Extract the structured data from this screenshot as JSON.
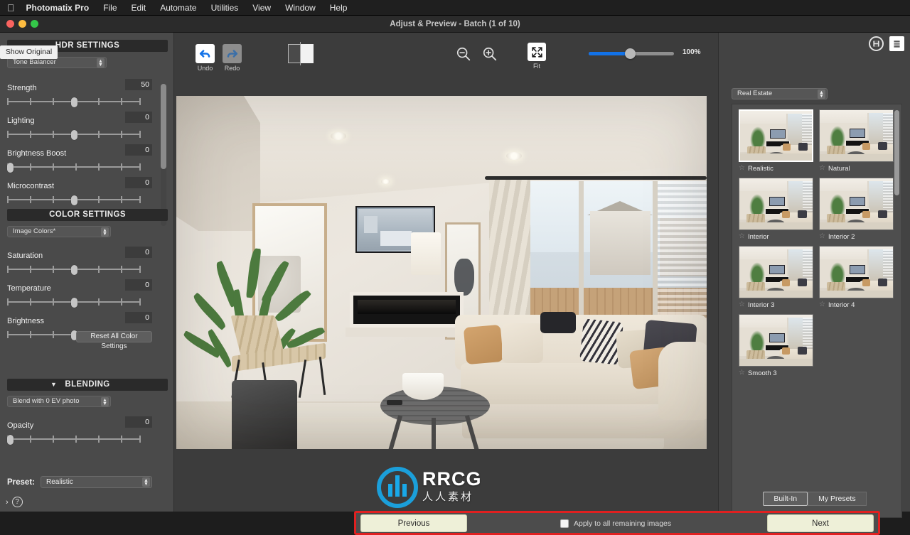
{
  "menubar": {
    "apple_icon": "apple-logo",
    "items": [
      "Photomatix Pro",
      "File",
      "Edit",
      "Automate",
      "Utilities",
      "View",
      "Window",
      "Help"
    ]
  },
  "window": {
    "title": "Adjust & Preview - Batch (1 of 10)",
    "traffic_lights": [
      "close",
      "minimize",
      "zoom"
    ]
  },
  "left_panel": {
    "hdr": {
      "header": "HDR SETTINGS",
      "method": "Tone Balancer",
      "sliders": [
        {
          "label": "Strength",
          "value": "50",
          "pos": 50
        },
        {
          "label": "Lighting",
          "value": "0",
          "pos": 50
        },
        {
          "label": "Brightness Boost",
          "value": "0",
          "pos": 2
        },
        {
          "label": "Microcontrast",
          "value": "0",
          "pos": 50
        }
      ]
    },
    "color": {
      "header": "COLOR SETTINGS",
      "mode": "Image Colors*",
      "sliders": [
        {
          "label": "Saturation",
          "value": "0",
          "pos": 50
        },
        {
          "label": "Temperature",
          "value": "0",
          "pos": 50
        },
        {
          "label": "Brightness",
          "value": "0",
          "pos": 50
        }
      ],
      "reset_label": "Reset All Color Settings"
    },
    "blending": {
      "header": "BLENDING",
      "chevron": "chevron-down-icon",
      "blend_with": "Blend with  0 EV photo",
      "sliders": [
        {
          "label": "Opacity",
          "value": "0",
          "pos": 2
        }
      ]
    },
    "preset_label": "Preset:",
    "preset_value": "Realistic",
    "help_chevron": "›",
    "help_icon": "?"
  },
  "toolbar": {
    "undo_label": "Undo",
    "redo_label": "Redo",
    "undo_icon": "undo-arrow-icon",
    "redo_icon": "redo-arrow-icon",
    "split_icon": "split-preview-icon",
    "show_original": "Show Original",
    "zoom_out_icon": "zoom-out-icon",
    "zoom_in_icon": "zoom-in-icon",
    "fit_label": "Fit",
    "fit_icon": "fit-to-screen-icon",
    "zoom_percent": "100%",
    "zoom_value": 100
  },
  "bottom_bar": {
    "previous": "Previous",
    "next": "Next",
    "apply_label": "Apply to all remaining images",
    "apply_checked": false,
    "highlight_color": "#e02020"
  },
  "right_panel": {
    "save_icon": "save-preset-icon",
    "list_icon": "list-view-icon",
    "category": "Real Estate",
    "presets": [
      {
        "name": "Realistic",
        "selected": true,
        "favorite": false
      },
      {
        "name": "Natural",
        "selected": false,
        "favorite": false
      },
      {
        "name": "Interior",
        "selected": false,
        "favorite": false
      },
      {
        "name": "Interior 2",
        "selected": false,
        "favorite": false
      },
      {
        "name": "Interior 3",
        "selected": false,
        "favorite": false
      },
      {
        "name": "Interior 4",
        "selected": false,
        "favorite": false
      },
      {
        "name": "Smooth 3",
        "selected": false,
        "favorite": false
      }
    ],
    "tabs": [
      {
        "label": "Built-In",
        "active": true
      },
      {
        "label": "My Presets",
        "active": false
      }
    ]
  },
  "watermark": {
    "text": "RRCG",
    "subtext": "人人素材",
    "color": "#19a8e8"
  },
  "colors": {
    "accent_blue": "#1272e8",
    "panel_bg": "#4a4a4a",
    "canvas_bg": "#3c3c3c",
    "button_cream": "#eef0d8"
  }
}
